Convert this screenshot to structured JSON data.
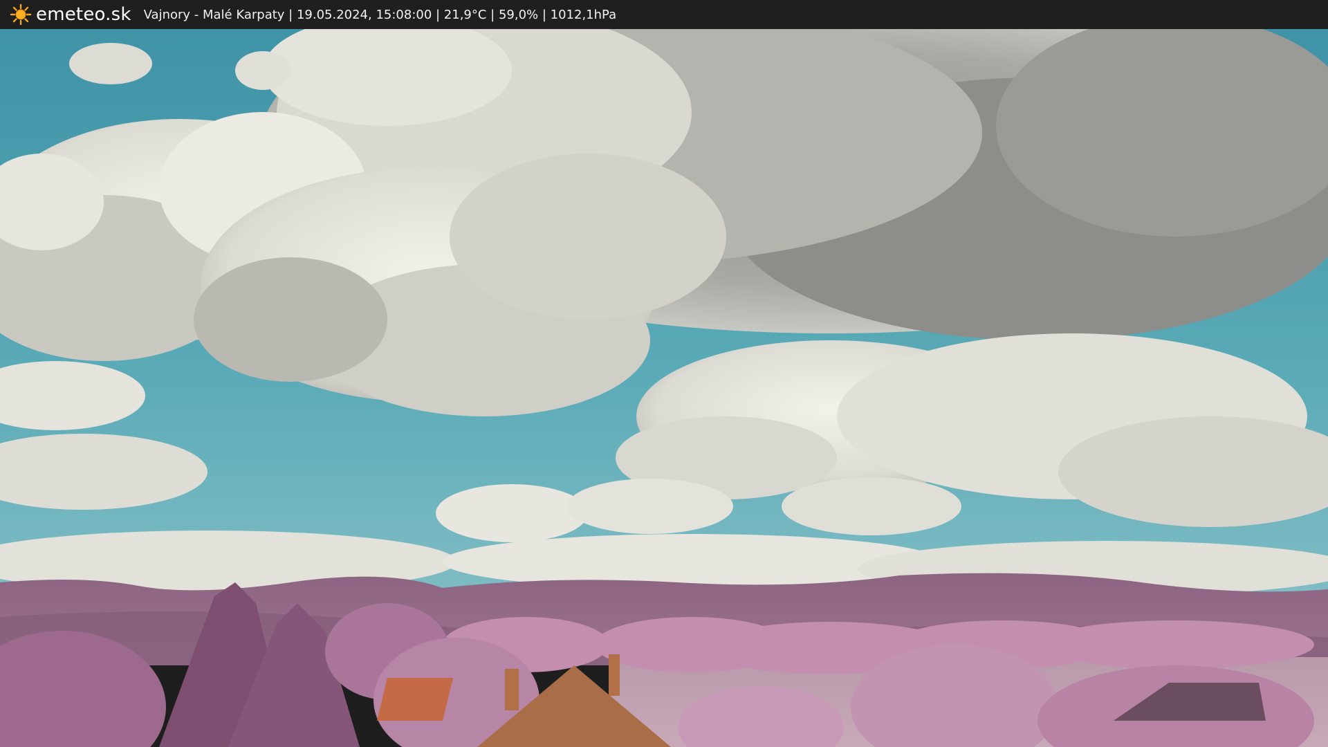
{
  "header": {
    "brand": "emeteo.sk",
    "logo_icon": "sun-icon",
    "caption": "Vajnory - Malé Karpaty | 19.05.2024, 15:08:00 | 21,9°C | 59,0% | 1012,1hPa"
  },
  "colors": {
    "bar": "#1f1f1f",
    "sun": "#f5a623",
    "sky": "#4fa3b2",
    "cloud": "#e6e6df",
    "foliage": "#b67a9c",
    "hills": "#8a5f7c",
    "roof": "#c98555"
  }
}
